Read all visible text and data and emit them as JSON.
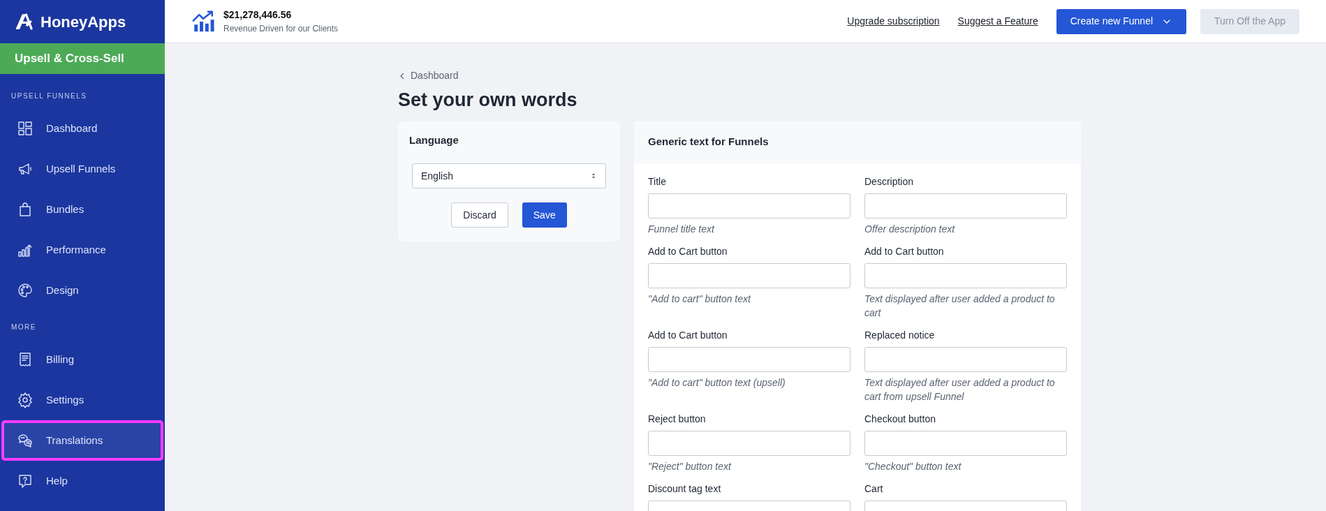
{
  "sidebar": {
    "brand": "HoneyApps",
    "app_name": "Upsell & Cross-Sell",
    "sections": [
      {
        "heading": "UPSELL FUNNELS",
        "items": [
          {
            "kind": "dashboard",
            "label": "Dashboard",
            "selected": false,
            "highlighted": false
          },
          {
            "kind": "megaphone",
            "label": "Upsell Funnels",
            "selected": false,
            "highlighted": false
          },
          {
            "kind": "bag",
            "label": "Bundles",
            "selected": false,
            "highlighted": false
          },
          {
            "kind": "chart",
            "label": "Performance",
            "selected": false,
            "highlighted": false
          },
          {
            "kind": "palette",
            "label": "Design",
            "selected": false,
            "highlighted": false
          }
        ]
      },
      {
        "heading": "MORE",
        "items": [
          {
            "kind": "receipt",
            "label": "Billing",
            "selected": false,
            "highlighted": false
          },
          {
            "kind": "gear",
            "label": "Settings",
            "selected": false,
            "highlighted": false
          },
          {
            "kind": "chat",
            "label": "Translations",
            "selected": true,
            "highlighted": true
          },
          {
            "kind": "help",
            "label": "Help",
            "selected": false,
            "highlighted": false
          }
        ]
      }
    ]
  },
  "header": {
    "revenue": "$21,278,446.56",
    "revenue_caption": "Revenue Driven for our Clients",
    "links": [
      "Upgrade subscription",
      "Suggest a Feature"
    ],
    "create_button": "Create new Funnel",
    "turn_off_button": "Turn Off the App"
  },
  "breadcrumb": "Dashboard",
  "page_title": "Set your own words",
  "language_card": {
    "title": "Language",
    "select_value": "English",
    "discard_button": "Discard",
    "save_button": "Save"
  },
  "form_card": {
    "title": "Generic text for Funnels",
    "fields": [
      {
        "label": "Title",
        "help": "Funnel title text"
      },
      {
        "label": "Description",
        "help": "Offer description text"
      },
      {
        "label": "Add to Cart button",
        "help": "\"Add to cart\" button text"
      },
      {
        "label": "Add to Cart button",
        "help": "Text displayed after user added a product to cart"
      },
      {
        "label": "Add to Cart button",
        "help": "\"Add to cart\" button text (upsell)"
      },
      {
        "label": "Replaced notice",
        "help": "Text displayed after user added a product to cart from upsell Funnel"
      },
      {
        "label": "Reject button",
        "help": "\"Reject\" button text"
      },
      {
        "label": "Checkout button",
        "help": "\"Checkout\" button text"
      },
      {
        "label": "Discount tag text"
      },
      {
        "label": "Cart"
      }
    ]
  }
}
